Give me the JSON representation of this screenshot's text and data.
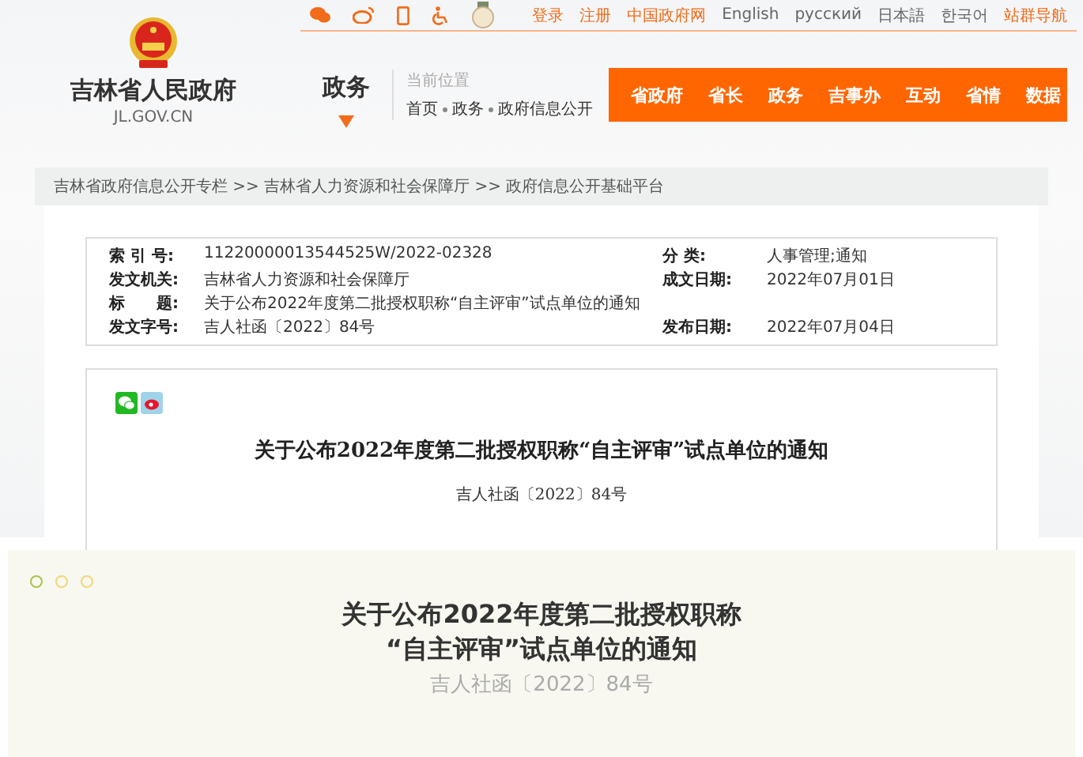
{
  "site": {
    "name": "吉林省人民政府",
    "domain": "JL.GOV.CN"
  },
  "top_links": [
    {
      "label": "登录",
      "kind": "accent"
    },
    {
      "label": "注册",
      "kind": "accent"
    },
    {
      "label": "中国政府网",
      "kind": "accent"
    },
    {
      "label": "English",
      "kind": "plain"
    },
    {
      "label": "русский",
      "kind": "plain"
    },
    {
      "label": "日本語",
      "kind": "plain"
    },
    {
      "label": "한국어",
      "kind": "plain"
    },
    {
      "label": "站群导航",
      "kind": "accent"
    }
  ],
  "section": {
    "title": "政务",
    "location_label": "当前位置",
    "crumbs": [
      "首页",
      "政务",
      "政府信息公开"
    ]
  },
  "nav": [
    {
      "label": "省政府"
    },
    {
      "label": "省长"
    },
    {
      "label": "政务"
    },
    {
      "label": "吉事办"
    },
    {
      "label": "互动"
    },
    {
      "label": "省情"
    },
    {
      "label": "数据"
    }
  ],
  "breadcrumb": "吉林省政府信息公开专栏 >> 吉林省人力资源和社会保障厅 >> 政府信息公开基础平台",
  "meta": [
    {
      "label": "索 引 号:",
      "value": "11220000013544525W/2022-02328",
      "label2": "分 类:",
      "value2": "人事管理;通知"
    },
    {
      "label": "发文机关:",
      "value": "吉林省人力资源和社会保障厅",
      "label2": "成文日期:",
      "value2": "2022年07月01日"
    },
    {
      "label": "标　　题:",
      "value": "关于公布2022年度第二批授权职称“自主评审”试点单位的通知"
    },
    {
      "label": "发文字号:",
      "value": "吉人社函〔2022〕84号",
      "label2": "发布日期:",
      "value2": "2022年07月04日"
    }
  ],
  "article": {
    "title": "关于公布2022年度第二批授权职称“自主评审”试点单位的通知",
    "doc_number": "吉人社函〔2022〕84号"
  },
  "card": {
    "title_lines": [
      "关于公布2022年度第二批授权职称",
      "“自主评审”试点单位的通知"
    ],
    "subtitle": "吉人社函〔2022〕84号"
  }
}
